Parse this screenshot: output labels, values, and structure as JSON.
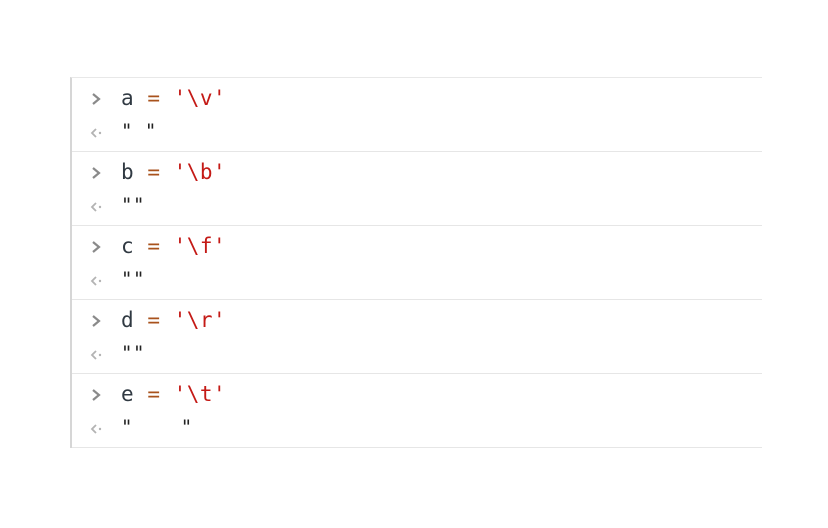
{
  "console": {
    "entries": [
      {
        "var": "a",
        "op": "=",
        "str": "'\\v'",
        "result": "\" \""
      },
      {
        "var": "b",
        "op": "=",
        "str": "'\\b'",
        "result": "\"\""
      },
      {
        "var": "c",
        "op": "=",
        "str": "'\\f'",
        "result": "\"\""
      },
      {
        "var": "d",
        "op": "=",
        "str": "'\\r'",
        "result": "\"\""
      },
      {
        "var": "e",
        "op": "=",
        "str": "'\\t'",
        "result": "\"    \""
      }
    ]
  },
  "icons": {
    "input_prompt": "chevron-right-icon",
    "output_prompt": "return-arrow-icon"
  },
  "colors": {
    "variable": "#303942",
    "operator": "#a8521c",
    "string": "#c41a16",
    "prompt": "#8a8a8a",
    "output_prompt": "#b3b3b3"
  }
}
